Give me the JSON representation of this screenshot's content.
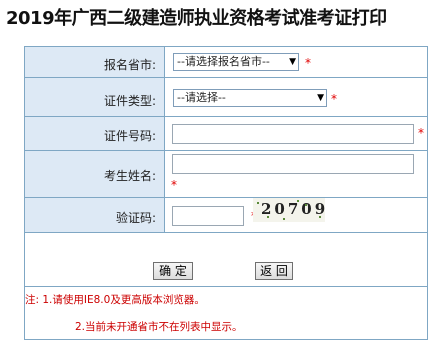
{
  "title": "2019年广西二级建造师执业资格考试准考证打印",
  "form": {
    "province_label": "报名省市:",
    "province_value": "--请选择报名省市--",
    "idtype_label": "证件类型:",
    "idtype_value": "--请选择--",
    "idnumber_label": "证件号码:",
    "name_label": "考生姓名:",
    "captcha_label": "验证码:",
    "captcha_text": "20709",
    "required_mark": "*"
  },
  "buttons": {
    "confirm": "确 定",
    "back": "返 回"
  },
  "notes": {
    "note1": "注: 1.请使用IE8.0及更高版本浏览器。",
    "note2": "2.当前未开通省市不在列表中显示。"
  },
  "colors": {
    "label_bg": "#dde9f5",
    "border": "#7fa7c4",
    "required": "#e00000"
  }
}
